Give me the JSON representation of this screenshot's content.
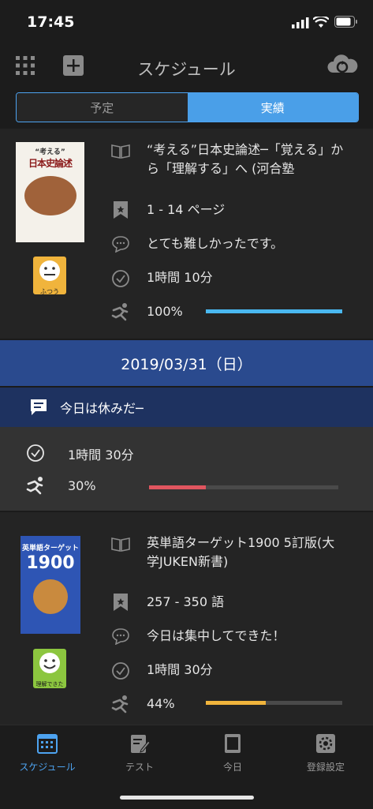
{
  "status": {
    "time": "17:45"
  },
  "header": {
    "title": "スケジュール"
  },
  "segment": {
    "left": "予定",
    "right": "実績"
  },
  "entry1": {
    "cover_top": "“考える”",
    "cover_main": "日本史論述",
    "title": "“考える”日本史論述─「覚える」から「理解する」へ (河合塾",
    "range": "1 - 14 ページ",
    "comment": "とても難しかったです。",
    "time": "1時間 10分",
    "progress": "100%",
    "progress_value": 1.0,
    "mood": "ふつう",
    "color": "#4ab8f0"
  },
  "date": {
    "label": "2019/03/31（日）"
  },
  "memo": {
    "text": "今日は休みだ─"
  },
  "summary": {
    "time": "1時間 30分",
    "progress": "30%",
    "progress_value": 0.3,
    "color": "#e0555f"
  },
  "entry2": {
    "cover_top": "英単語ターゲット",
    "cover_num": "1900",
    "title": "英単語ターゲット1900 5訂版(大学JUKEN新書)",
    "range": "257 - 350 語",
    "comment": "今日は集中してできた！",
    "time": "1時間 30分",
    "progress": "44%",
    "progress_value": 0.44,
    "mood": "理解できた",
    "color": "#f0b43c"
  },
  "tabs": [
    {
      "label": "スケジュール",
      "active": true
    },
    {
      "label": "テスト"
    },
    {
      "label": "今日"
    },
    {
      "label": "登録設定"
    }
  ],
  "colors": {
    "accent": "#4da3f0",
    "mood1": "#f0b43c",
    "mood2": "#8cc63f"
  }
}
